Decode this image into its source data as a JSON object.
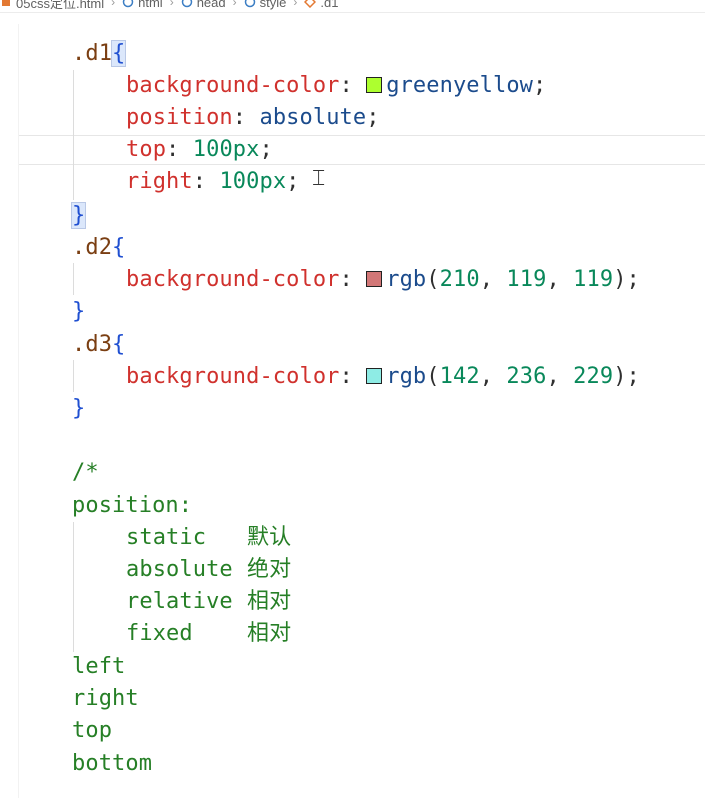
{
  "breadcrumb": [
    "05css定位.html",
    "html",
    "head",
    "style",
    ".d1"
  ],
  "code": {
    "d1": {
      "selector": ".d1",
      "open": "{",
      "bg_prop": "background-color",
      "bg_value": "greenyellow",
      "bg_swatch": "#adff2f",
      "pos_prop": "position",
      "pos_value": "absolute",
      "top_prop": "top",
      "top_value": "100px",
      "right_prop": "right",
      "right_value": "100px",
      "close": "}"
    },
    "d2": {
      "selector": ".d2",
      "open": "{",
      "bg_prop": "background-color",
      "bg_func": "rgb",
      "bg_r": "210",
      "bg_g": "119",
      "bg_b": "119",
      "bg_swatch": "#d27777",
      "close": "}"
    },
    "d3": {
      "selector": ".d3",
      "open": "{",
      "bg_prop": "background-color",
      "bg_func": "rgb",
      "bg_r": "142",
      "bg_g": "236",
      "bg_b": "229",
      "bg_swatch": "#8eece5",
      "close": "}"
    },
    "comment": {
      "open": "/*",
      "heading": "position:",
      "items": [
        {
          "keyword": "static",
          "note": "默认"
        },
        {
          "keyword": "absolute",
          "note": "绝对"
        },
        {
          "keyword": "relative",
          "note": "相对"
        },
        {
          "keyword": "fixed",
          "note": "相对"
        }
      ],
      "offsets": [
        "left",
        "right",
        "top",
        "bottom"
      ]
    }
  },
  "colors": {
    "property": "#d0312d",
    "value": "#1b4b8c",
    "number": "#09885a",
    "comment": "#267f26",
    "brace": "#1f4fd1"
  }
}
